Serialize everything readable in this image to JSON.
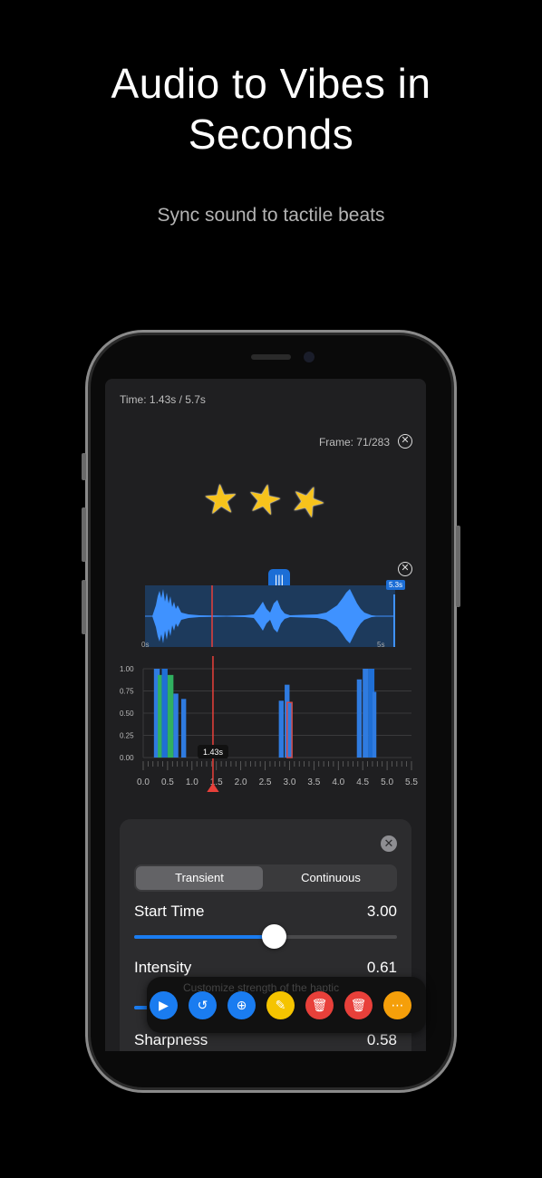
{
  "hero": {
    "title_line1": "Audio to Vibes in",
    "title_line2": "Seconds",
    "subtitle": "Sync sound to tactile beats"
  },
  "editor": {
    "time_text": "Time: 1.43s / 5.7s",
    "frame_text": "Frame: 71/283",
    "stars_count": 3,
    "waveform": {
      "start_label": "0s",
      "end_label": "5s",
      "selection_end_badge": "5.3s",
      "playhead_fraction": 0.25
    }
  },
  "chart_data": {
    "type": "bar",
    "x_ticks": [
      "0.0",
      "0.5",
      "1.0",
      "1.5",
      "2.0",
      "2.5",
      "3.0",
      "3.5",
      "4.0",
      "4.5",
      "5.0",
      "5.5"
    ],
    "y_ticks": [
      "1.00",
      "0.75",
      "0.50",
      "0.25",
      "0.00"
    ],
    "xlim": [
      0,
      5.5
    ],
    "ylim": [
      0,
      1
    ],
    "playhead_label": "1.43s",
    "playhead_x": 1.43,
    "bars": [
      {
        "x": 0.22,
        "w": 0.12,
        "y": 1.0,
        "color": "#2f7be0"
      },
      {
        "x": 0.3,
        "w": 0.08,
        "y": 0.93,
        "color": "#30b060"
      },
      {
        "x": 0.38,
        "w": 0.12,
        "y": 1.0,
        "color": "#1f6fd6"
      },
      {
        "x": 0.5,
        "w": 0.12,
        "y": 0.93,
        "color": "#30b060"
      },
      {
        "x": 0.62,
        "w": 0.1,
        "y": 0.72,
        "color": "#2f7be0"
      },
      {
        "x": 0.78,
        "w": 0.1,
        "y": 0.66,
        "color": "#2f7be0"
      },
      {
        "x": 2.78,
        "w": 0.1,
        "y": 0.64,
        "color": "#2f7be0"
      },
      {
        "x": 2.9,
        "w": 0.1,
        "y": 0.82,
        "color": "#2f7be0"
      },
      {
        "x": 2.95,
        "w": 0.1,
        "y": 0.62,
        "color": "#d24b4b"
      },
      {
        "x": 4.38,
        "w": 0.1,
        "y": 0.88,
        "color": "#2f7be0"
      },
      {
        "x": 4.5,
        "w": 0.12,
        "y": 1.0,
        "color": "#2f7be0"
      },
      {
        "x": 4.62,
        "w": 0.12,
        "y": 1.0,
        "color": "#1f6fd6"
      },
      {
        "x": 4.7,
        "w": 0.08,
        "y": 0.74,
        "color": "#2f7be0"
      }
    ]
  },
  "panel": {
    "tabs": [
      "Transient",
      "Continuous"
    ],
    "active_tab": "Transient",
    "start_time_label": "Start Time",
    "start_time_value": "3.00",
    "start_time_fraction": 0.53,
    "intensity_label": "Intensity",
    "intensity_value": "0.61",
    "sharpness_label": "Sharpness",
    "sharpness_value": "0.58",
    "ghost_text": "Customize strength of the haptic"
  },
  "toolbar": {
    "buttons": [
      {
        "name": "play-icon",
        "color": "#1a7cf0",
        "glyph": "▶"
      },
      {
        "name": "undo-icon",
        "color": "#1a7cf0",
        "glyph": "↺"
      },
      {
        "name": "add-icon",
        "color": "#1a7cf0",
        "glyph": "⊕"
      },
      {
        "name": "pencil-icon",
        "color": "#f5c400",
        "glyph": "✎"
      },
      {
        "name": "trash-icon",
        "color": "#e8403a",
        "glyph": "🗑"
      },
      {
        "name": "trash-all-icon",
        "color": "#e8403a",
        "glyph": "🗑"
      },
      {
        "name": "more-icon",
        "color": "#f59f0a",
        "glyph": "⋯"
      }
    ]
  }
}
